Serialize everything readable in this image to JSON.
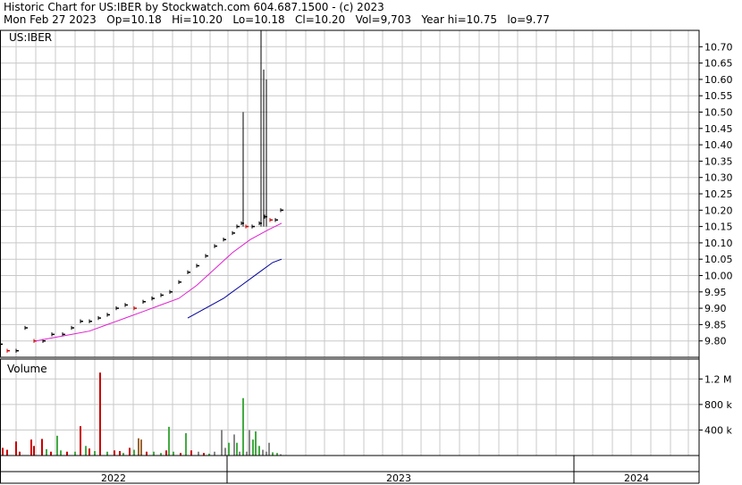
{
  "header": {
    "line1": "Historic Chart for US:IBER by Stockwatch.com 604.687.1500 - (c) 2023",
    "line2": "Mon Feb 27 2023   Op=10.18   Hi=10.20   Lo=10.18   Cl=10.20   Vol=9,703   Year hi=10.75   lo=9.77"
  },
  "price_panel": {
    "symbol": "US:IBER"
  },
  "volume_panel": {
    "title": "Volume"
  },
  "colors": {
    "up": "#000000",
    "down": "#cc0000",
    "ma_short": "#e020d0",
    "ma_long": "#000099",
    "vol_up": "#44aa44",
    "vol_down": "#cc0000",
    "vol_flat": "#888888",
    "vol_other": "#996633",
    "grid": "#c8c8c8"
  },
  "chart_data": [
    {
      "type": "line",
      "name": "price",
      "ylim": [
        9.75,
        10.75
      ],
      "yticks": [
        "10.70",
        "10.65",
        "10.60",
        "10.55",
        "10.50",
        "10.45",
        "10.40",
        "10.35",
        "10.30",
        "10.25",
        "10.20",
        "10.15",
        "10.10",
        "10.05",
        "10.00",
        "9.95",
        "9.90",
        "9.85",
        "9.80"
      ],
      "xlabels": [
        "2022",
        "2023",
        "2024"
      ],
      "series": [
        {
          "role": "close",
          "points": [
            [
              0,
              9.79
            ],
            [
              8,
              9.77
            ],
            [
              18,
              9.77
            ],
            [
              28,
              9.84
            ],
            [
              38,
              9.8
            ],
            [
              48,
              9.8
            ],
            [
              58,
              9.82
            ],
            [
              70,
              9.82
            ],
            [
              80,
              9.84
            ],
            [
              90,
              9.86
            ],
            [
              100,
              9.86
            ],
            [
              110,
              9.87
            ],
            [
              120,
              9.88
            ],
            [
              130,
              9.9
            ],
            [
              140,
              9.91
            ],
            [
              150,
              9.9
            ],
            [
              160,
              9.92
            ],
            [
              170,
              9.93
            ],
            [
              180,
              9.94
            ],
            [
              190,
              9.95
            ],
            [
              200,
              9.98
            ],
            [
              210,
              10.01
            ],
            [
              220,
              10.03
            ],
            [
              230,
              10.06
            ],
            [
              240,
              10.09
            ],
            [
              250,
              10.11
            ],
            [
              260,
              10.13
            ],
            [
              265,
              10.15
            ],
            [
              270,
              10.16
            ],
            [
              275,
              10.15
            ],
            [
              282,
              10.15
            ],
            [
              290,
              10.16
            ],
            [
              296,
              10.18
            ],
            [
              302,
              10.17
            ],
            [
              308,
              10.17
            ],
            [
              314,
              10.2
            ]
          ]
        },
        {
          "role": "spike_highs",
          "points": [
            [
              272,
              10.5
            ],
            [
              292,
              10.75
            ],
            [
              295,
              10.63
            ],
            [
              298,
              10.6
            ]
          ]
        },
        {
          "role": "ma_short",
          "points": [
            [
              40,
              9.8
            ],
            [
              60,
              9.81
            ],
            [
              80,
              9.82
            ],
            [
              100,
              9.83
            ],
            [
              120,
              9.85
            ],
            [
              140,
              9.87
            ],
            [
              160,
              9.89
            ],
            [
              180,
              9.91
            ],
            [
              200,
              9.93
            ],
            [
              220,
              9.97
            ],
            [
              240,
              10.02
            ],
            [
              260,
              10.07
            ],
            [
              280,
              10.11
            ],
            [
              300,
              10.14
            ],
            [
              315,
              10.16
            ]
          ]
        },
        {
          "role": "ma_long",
          "points": [
            [
              210,
              9.87
            ],
            [
              230,
              9.9
            ],
            [
              250,
              9.93
            ],
            [
              270,
              9.97
            ],
            [
              290,
              10.01
            ],
            [
              305,
              10.04
            ],
            [
              315,
              10.05
            ]
          ]
        }
      ]
    },
    {
      "type": "bar",
      "name": "volume",
      "yticks": [
        "1.2 M",
        "800 k",
        "400 k"
      ],
      "ylim": [
        0,
        1400000
      ],
      "bars": [
        [
          3,
          120000,
          "down"
        ],
        [
          8,
          90000,
          "down"
        ],
        [
          18,
          220000,
          "down"
        ],
        [
          22,
          60000,
          "down"
        ],
        [
          35,
          250000,
          "down"
        ],
        [
          38,
          150000,
          "down"
        ],
        [
          47,
          260000,
          "down"
        ],
        [
          52,
          100000,
          "up"
        ],
        [
          57,
          60000,
          "down"
        ],
        [
          64,
          310000,
          "up"
        ],
        [
          68,
          80000,
          "up"
        ],
        [
          75,
          60000,
          "down"
        ],
        [
          84,
          60000,
          "up"
        ],
        [
          90,
          460000,
          "down"
        ],
        [
          96,
          150000,
          "up"
        ],
        [
          100,
          110000,
          "down"
        ],
        [
          106,
          70000,
          "up"
        ],
        [
          112,
          1300000,
          "down"
        ],
        [
          120,
          60000,
          "up"
        ],
        [
          128,
          80000,
          "down"
        ],
        [
          134,
          70000,
          "down"
        ],
        [
          138,
          40000,
          "up"
        ],
        [
          145,
          120000,
          "down"
        ],
        [
          150,
          90000,
          "up"
        ],
        [
          155,
          270000,
          "other"
        ],
        [
          158,
          250000,
          "other"
        ],
        [
          164,
          60000,
          "down"
        ],
        [
          172,
          60000,
          "up"
        ],
        [
          180,
          40000,
          "up"
        ],
        [
          186,
          80000,
          "down"
        ],
        [
          189,
          450000,
          "up"
        ],
        [
          194,
          60000,
          "up"
        ],
        [
          202,
          40000,
          "down"
        ],
        [
          208,
          350000,
          "up"
        ],
        [
          214,
          80000,
          "down"
        ],
        [
          222,
          60000,
          "flat"
        ],
        [
          228,
          40000,
          "down"
        ],
        [
          234,
          30000,
          "up"
        ],
        [
          240,
          60000,
          "flat"
        ],
        [
          248,
          400000,
          "flat"
        ],
        [
          252,
          120000,
          "flat"
        ],
        [
          256,
          200000,
          "up"
        ],
        [
          262,
          330000,
          "flat"
        ],
        [
          265,
          200000,
          "up"
        ],
        [
          268,
          60000,
          "flat"
        ],
        [
          272,
          900000,
          "up"
        ],
        [
          276,
          60000,
          "flat"
        ],
        [
          279,
          400000,
          "flat"
        ],
        [
          283,
          250000,
          "up"
        ],
        [
          286,
          380000,
          "up"
        ],
        [
          290,
          150000,
          "up"
        ],
        [
          294,
          90000,
          "flat"
        ],
        [
          298,
          60000,
          "flat"
        ],
        [
          301,
          200000,
          "flat"
        ],
        [
          305,
          50000,
          "up"
        ],
        [
          310,
          40000,
          "up"
        ],
        [
          314,
          20000,
          "flat"
        ]
      ]
    }
  ]
}
